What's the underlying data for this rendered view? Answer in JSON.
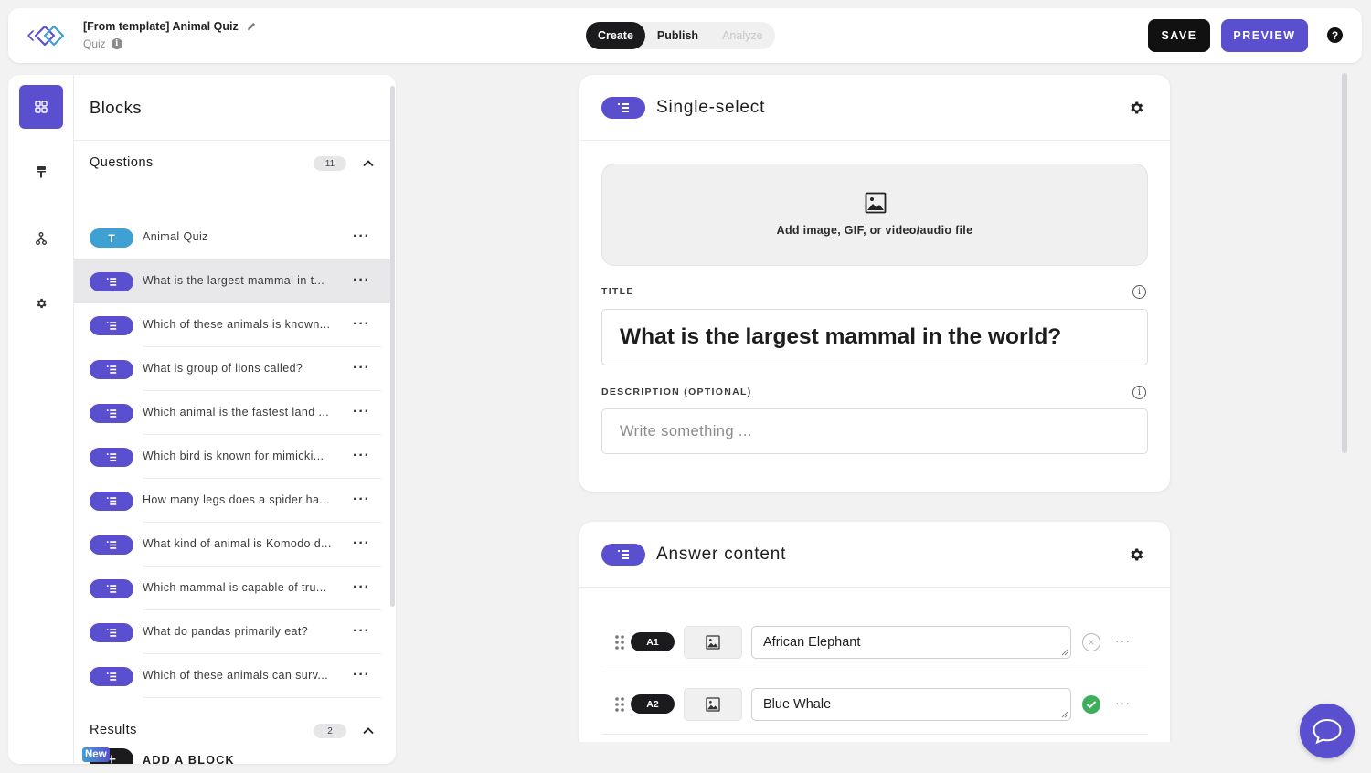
{
  "header": {
    "doc_title": "[From template] Animal Quiz",
    "doc_type": "Quiz",
    "tabs": [
      {
        "label": "Create",
        "state": "active"
      },
      {
        "label": "Publish",
        "state": "normal"
      },
      {
        "label": "Analyze",
        "state": "disabled"
      }
    ],
    "save_label": "SAVE",
    "preview_label": "PREVIEW",
    "help_label": "?"
  },
  "sidebar": {
    "title": "Blocks",
    "questions_label": "Questions",
    "questions_count": "11",
    "items": [
      {
        "badge": "T",
        "text": "Animal Quiz"
      },
      {
        "badge": "",
        "text": "What is the largest mammal in t..."
      },
      {
        "badge": "",
        "text": "Which of these animals is known..."
      },
      {
        "badge": "",
        "text": "What is group of lions called?"
      },
      {
        "badge": "",
        "text": "Which animal is the fastest land ..."
      },
      {
        "badge": "",
        "text": "Which bird is known for mimicki..."
      },
      {
        "badge": "",
        "text": "How many legs does a spider ha..."
      },
      {
        "badge": "",
        "text": "What kind of animal is Komodo d..."
      },
      {
        "badge": "",
        "text": "Which mammal is capable of tru..."
      },
      {
        "badge": "",
        "text": "What do pandas primarily eat?"
      },
      {
        "badge": "",
        "text": "Which of these animals can surv..."
      }
    ],
    "more_glyph": "···",
    "add_block_label": "ADD A BLOCK",
    "add_glyph": "+",
    "results_label": "Results",
    "results_count": "2",
    "new_badge": "New"
  },
  "question_card": {
    "type_label": "Single-select",
    "media_prompt": "Add image, GIF, or video/audio file",
    "title_label": "TITLE",
    "title_value": "What is the largest mammal in the world?",
    "description_label": "DESCRIPTION (OPTIONAL)",
    "description_placeholder": "Write something ...",
    "info_glyph": "i"
  },
  "answer_card": {
    "title": "Answer content",
    "answers": [
      {
        "key": "A1",
        "value": "African Elephant",
        "correct": false
      },
      {
        "key": "A2",
        "value": "Blue Whale",
        "correct": true
      }
    ],
    "wrong_glyph": "×",
    "more_glyph": "···"
  },
  "colors": {
    "accent": "#5a4fcf",
    "text_badge": "#3fa0d2",
    "correct": "#3dae5a",
    "dark": "#1b1b1d"
  }
}
